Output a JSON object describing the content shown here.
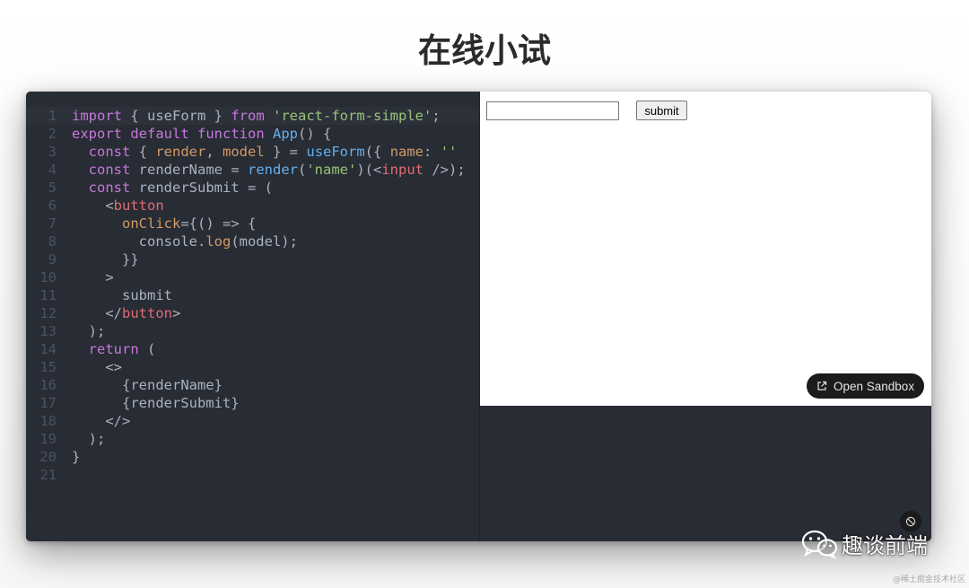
{
  "page": {
    "title": "在线小试"
  },
  "editor": {
    "lines": [
      {
        "n": "1",
        "tokens": [
          [
            "k",
            "import"
          ],
          [
            "d",
            " { useForm } "
          ],
          [
            "k",
            "from"
          ],
          [
            "d",
            " "
          ],
          [
            "s",
            "'react-form-simple'"
          ],
          [
            "d",
            ";"
          ]
        ]
      },
      {
        "n": "2",
        "tokens": [
          [
            "k",
            "export"
          ],
          [
            "d",
            " "
          ],
          [
            "k",
            "default"
          ],
          [
            "d",
            " "
          ],
          [
            "k",
            "function"
          ],
          [
            "d",
            " "
          ],
          [
            "f",
            "App"
          ],
          [
            "d",
            "() {"
          ]
        ]
      },
      {
        "n": "3",
        "tokens": [
          [
            "d",
            "  "
          ],
          [
            "k",
            "const"
          ],
          [
            "d",
            " { "
          ],
          [
            "p",
            "render"
          ],
          [
            "d",
            ", "
          ],
          [
            "p",
            "model"
          ],
          [
            "d",
            " } = "
          ],
          [
            "f",
            "useForm"
          ],
          [
            "d",
            "({ "
          ],
          [
            "p",
            "name"
          ],
          [
            "d",
            ": "
          ],
          [
            "s",
            "''"
          ]
        ]
      },
      {
        "n": "4",
        "tokens": [
          [
            "d",
            "  "
          ],
          [
            "k",
            "const"
          ],
          [
            "d",
            " renderName = "
          ],
          [
            "f",
            "render"
          ],
          [
            "d",
            "("
          ],
          [
            "s",
            "'name'"
          ],
          [
            "d",
            ")(<"
          ],
          [
            "t",
            "input"
          ],
          [
            "d",
            " />);"
          ]
        ]
      },
      {
        "n": "5",
        "tokens": [
          [
            "d",
            "  "
          ],
          [
            "k",
            "const"
          ],
          [
            "d",
            " renderSubmit = ("
          ]
        ]
      },
      {
        "n": "6",
        "tokens": [
          [
            "d",
            "    <"
          ],
          [
            "t",
            "button"
          ]
        ]
      },
      {
        "n": "7",
        "tokens": [
          [
            "d",
            "      "
          ],
          [
            "p",
            "onClick"
          ],
          [
            "d",
            "={() => {"
          ]
        ]
      },
      {
        "n": "8",
        "tokens": [
          [
            "d",
            "        console."
          ],
          [
            "p",
            "log"
          ],
          [
            "d",
            "(model);"
          ]
        ]
      },
      {
        "n": "9",
        "tokens": [
          [
            "d",
            "      }}"
          ]
        ]
      },
      {
        "n": "10",
        "tokens": [
          [
            "d",
            "    >"
          ]
        ]
      },
      {
        "n": "11",
        "tokens": [
          [
            "d",
            "      submit"
          ]
        ]
      },
      {
        "n": "12",
        "tokens": [
          [
            "d",
            "    </"
          ],
          [
            "t",
            "button"
          ],
          [
            "d",
            ">"
          ]
        ]
      },
      {
        "n": "13",
        "tokens": [
          [
            "d",
            "  );"
          ]
        ]
      },
      {
        "n": "14",
        "tokens": [
          [
            "d",
            "  "
          ],
          [
            "k",
            "return"
          ],
          [
            "d",
            " ("
          ]
        ]
      },
      {
        "n": "15",
        "tokens": [
          [
            "d",
            "    <>"
          ]
        ]
      },
      {
        "n": "16",
        "tokens": [
          [
            "d",
            "      {renderName}"
          ]
        ]
      },
      {
        "n": "17",
        "tokens": [
          [
            "d",
            "      {renderSubmit}"
          ]
        ]
      },
      {
        "n": "18",
        "tokens": [
          [
            "d",
            "    </>"
          ]
        ]
      },
      {
        "n": "19",
        "tokens": [
          [
            "d",
            "  );"
          ]
        ]
      },
      {
        "n": "20",
        "tokens": [
          [
            "d",
            "}"
          ]
        ]
      },
      {
        "n": "21",
        "tokens": []
      }
    ]
  },
  "preview": {
    "input_value": "",
    "submit_label": "submit",
    "open_sandbox_label": "Open Sandbox"
  },
  "console": {
    "clear_icon": "clear-console-icon"
  },
  "watermark": {
    "label": "趣谈前端",
    "icon": "wechat-icon"
  },
  "credit": "@稀土掘金技术社区",
  "colors": {
    "editor_bg": "#282c34",
    "keyword": "#c678dd",
    "string": "#98c379",
    "function": "#61afef",
    "property": "#d19a66",
    "tag": "#e06c75",
    "text": "#abb2bf",
    "line_number": "#4b5263"
  }
}
